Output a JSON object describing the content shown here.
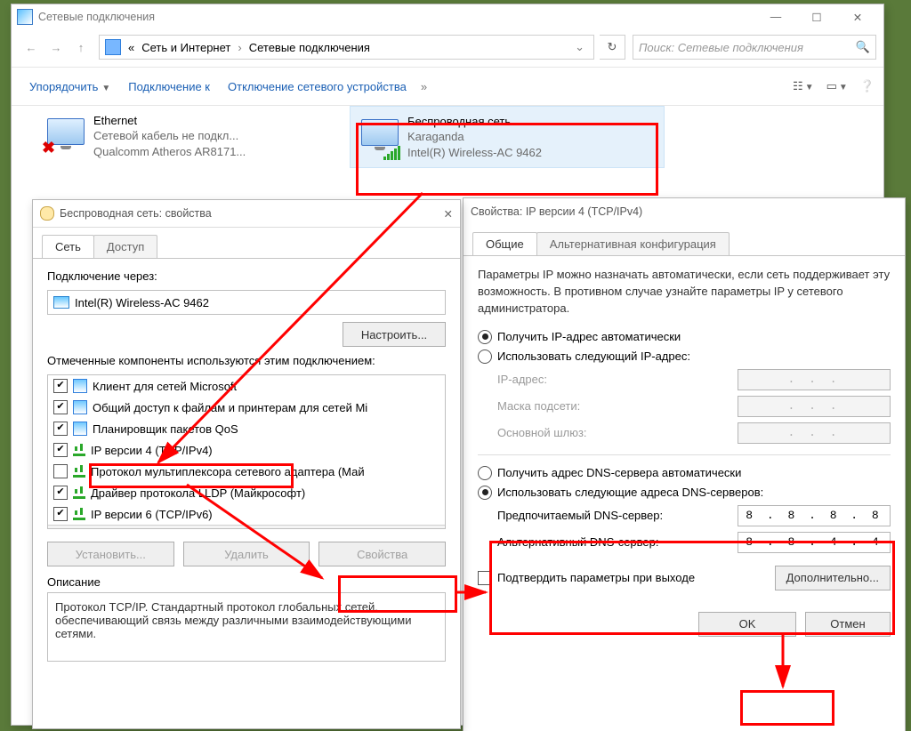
{
  "main": {
    "title": "Сетевые подключения",
    "breadcrumb": {
      "root": "«",
      "p1": "Сеть и Интернет",
      "p2": "Сетевые подключения"
    },
    "search_placeholder": "Поиск: Сетевые подключения",
    "cmd": {
      "organize": "Упорядочить",
      "connect": "Подключение к",
      "disable": "Отключение сетевого устройства"
    },
    "connections": {
      "ethernet": {
        "name": "Ethernet",
        "status": "Сетевой кабель не подкл...",
        "adapter": "Qualcomm Atheros AR8171..."
      },
      "wifi": {
        "name": "Беспроводная сеть",
        "status": "Karaganda",
        "adapter": "Intel(R) Wireless-AC 9462"
      }
    }
  },
  "props": {
    "title": "Беспроводная сеть: свойства",
    "tabs": {
      "net": "Сеть",
      "access": "Доступ"
    },
    "connect_via": "Подключение через:",
    "adapter": "Intel(R) Wireless-AC 9462",
    "configure": "Настроить...",
    "components_label": "Отмеченные компоненты используются этим подключением:",
    "items": [
      {
        "checked": true,
        "icon": "blue",
        "label": "Клиент для сетей Microsoft"
      },
      {
        "checked": true,
        "icon": "blue",
        "label": "Общий доступ к файлам и принтерам для сетей Mi"
      },
      {
        "checked": true,
        "icon": "blue",
        "label": "Планировщик пакетов QoS"
      },
      {
        "checked": true,
        "icon": "grn",
        "label": "IP версии 4 (TCP/IPv4)"
      },
      {
        "checked": false,
        "icon": "grn",
        "label": "Протокол мультиплексора сетевого адаптера (Май"
      },
      {
        "checked": true,
        "icon": "grn",
        "label": "Драйвер протокола LLDP (Майкрософт)"
      },
      {
        "checked": true,
        "icon": "grn",
        "label": "IP версии 6 (TCP/IPv6)"
      }
    ],
    "install": "Установить...",
    "remove": "Удалить",
    "properties": "Свойства",
    "desc_label": "Описание",
    "desc": "Протокол TCP/IP. Стандартный протокол глобальных сетей, обеспечивающий связь между различными взаимодействующими сетями."
  },
  "ip": {
    "title": "Свойства: IP версии 4 (TCP/IPv4)",
    "tabs": {
      "general": "Общие",
      "alt": "Альтернативная конфигурация"
    },
    "info": "Параметры IP можно назначать автоматически, если сеть поддерживает эту возможность. В противном случае узнайте параметры IP у сетевого администратора.",
    "r_auto_ip": "Получить IP-адрес автоматически",
    "r_manual_ip": "Использовать следующий IP-адрес:",
    "lbl_ip": "IP-адрес:",
    "lbl_mask": "Маска подсети:",
    "lbl_gw": "Основной шлюз:",
    "r_auto_dns": "Получить адрес DNS-сервера автоматически",
    "r_manual_dns": "Использовать следующие адреса DNS-серверов:",
    "lbl_dns1": "Предпочитаемый DNS-сервер:",
    "lbl_dns2": "Альтернативный DNS-сервер:",
    "val_dns1": "8 . 8 . 8 . 8",
    "val_dns2": "8 . 8 . 4 . 4",
    "dotted": ".   .   .",
    "validate": "Подтвердить параметры при выходе",
    "advanced": "Дополнительно...",
    "ok": "OK",
    "cancel": "Отмен"
  }
}
